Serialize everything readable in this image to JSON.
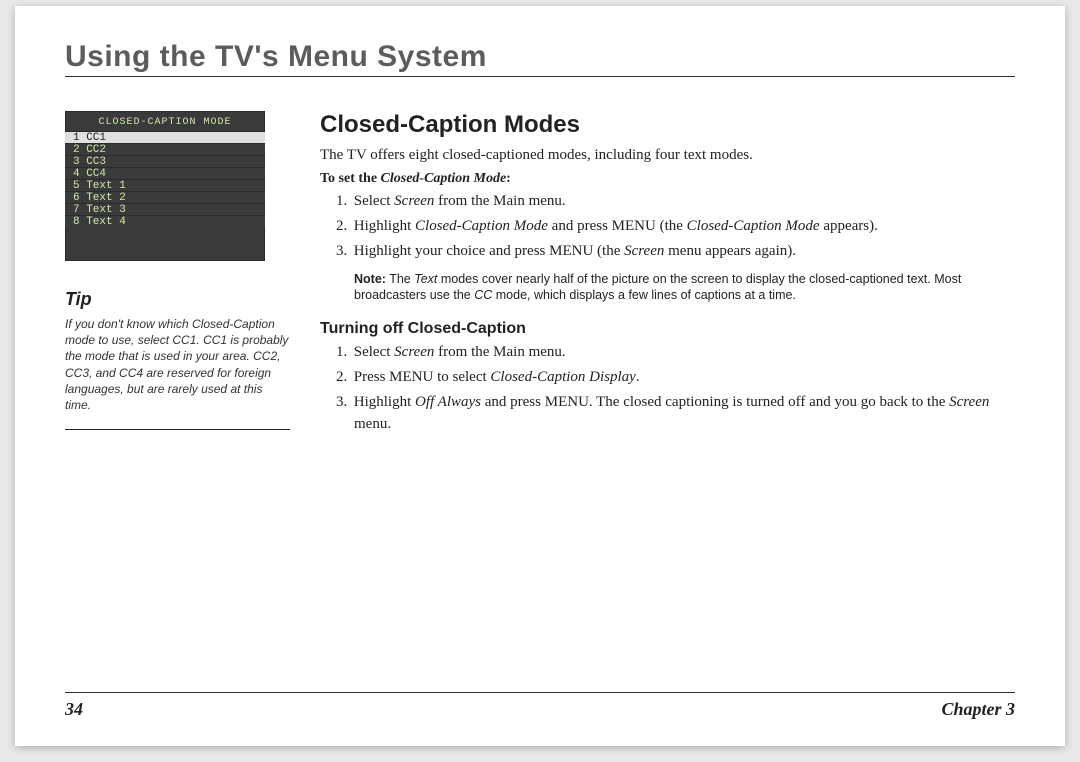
{
  "header": {
    "title": "Using the TV's Menu System"
  },
  "tvshot": {
    "title": "CLOSED-CAPTION MODE",
    "items": [
      "1 CC1",
      "2 CC2",
      "3 CC3",
      "4 CC4",
      "5 Text 1",
      "6 Text 2",
      "7 Text 3",
      "8 Text 4"
    ]
  },
  "tip": {
    "heading": "Tip",
    "body": "If you don't know which Closed-Caption mode to use, select CC1. CC1 is probably the mode that is used in your area. CC2, CC3, and CC4 are reserved for foreign languages, but are rarely used at this time."
  },
  "main": {
    "h2": "Closed-Caption Modes",
    "intro": "The TV offers eight closed-captioned modes, including four text modes.",
    "instr_head_prefix": "To set the ",
    "instr_head_em": "Closed-Caption Mode",
    "instr_head_suffix": ":",
    "steps1": {
      "n1": "1.",
      "s1a": "Select ",
      "s1b": "Screen",
      "s1c": " from the Main menu.",
      "n2": "2.",
      "s2a": "Highlight ",
      "s2b": "Closed-Caption Mode",
      "s2c": " and press MENU (the ",
      "s2d": "Closed-Caption Mode",
      "s2e": " appears).",
      "n3": "3.",
      "s3a": "Highlight your choice and press MENU (the ",
      "s3b": "Screen",
      "s3c": " menu appears again)."
    },
    "note_label": "Note:",
    "note_a": " The ",
    "note_em1": "Text",
    "note_b": " modes cover nearly half of the picture on the screen to display the closed-captioned text. Most broadcasters use the ",
    "note_em2": "CC",
    "note_c": " mode, which displays a few lines of captions at a time.",
    "h3": "Turning off Closed-Caption",
    "steps2": {
      "n1": "1.",
      "t1a": "Select ",
      "t1b": "Screen",
      "t1c": " from the Main menu.",
      "n2": "2.",
      "t2a": "Press MENU to select ",
      "t2b": "Closed-Caption Display",
      "t2c": ".",
      "n3": "3.",
      "t3a": "Highlight ",
      "t3b": "Off Always",
      "t3c": " and press MENU. The closed captioning is turned off and you go back to the ",
      "t3d": "Screen",
      "t3e": " menu."
    }
  },
  "footer": {
    "page": "34",
    "chapter": "Chapter 3"
  }
}
